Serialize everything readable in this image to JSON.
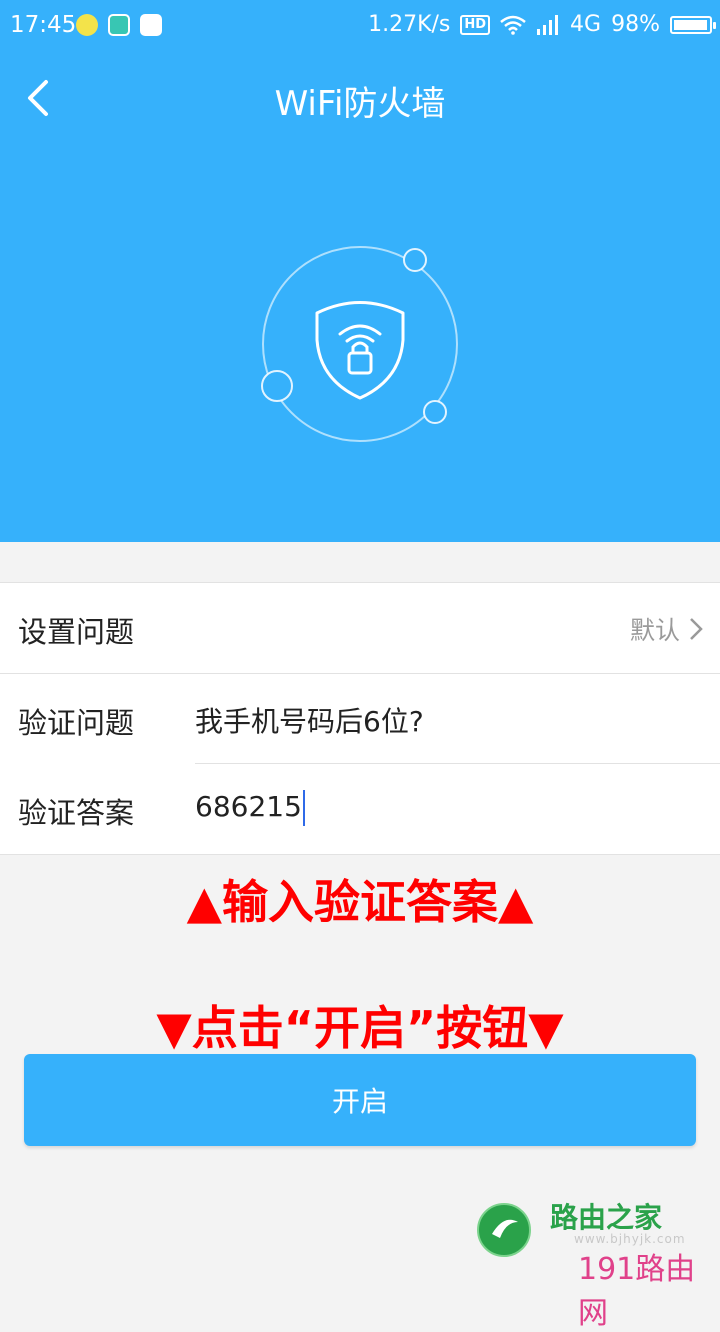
{
  "status_bar": {
    "time": "17:45",
    "net_speed": "1.27K/s",
    "hd": "HD",
    "network": "4G",
    "battery": "98%",
    "battery_level": 0.98
  },
  "app_bar": {
    "title": "WiFi防火墙"
  },
  "form": {
    "set_question": {
      "label": "设置问题",
      "value": "默认"
    },
    "verify_question": {
      "label": "验证问题",
      "value": "我手机号码后6位?"
    },
    "verify_answer": {
      "label": "验证答案",
      "value": "686215"
    }
  },
  "annotations": {
    "top": "▲输入验证答案▲",
    "bottom": "▼点击“开启”按钮▼"
  },
  "enable_button": {
    "label": "开启"
  },
  "watermark": {
    "brand": "路由之家",
    "url": "www.bjhyjk.com",
    "site": "191路由网"
  },
  "colors": {
    "primary": "#36b1fb",
    "annotation": "#ff0000",
    "caret": "#2f6ae8"
  },
  "icons": [
    "back-arrow-icon",
    "shield-lock-icon",
    "chevron-right-icon",
    "wifi-icon",
    "signal-icon",
    "battery-icon"
  ]
}
